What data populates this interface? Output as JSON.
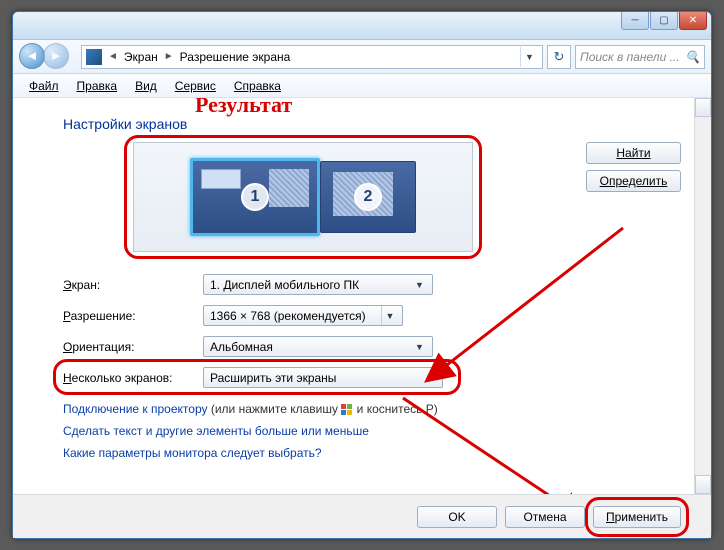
{
  "breadcrumb": {
    "item1": "Экран",
    "item2": "Разрешение экрана"
  },
  "search": {
    "placeholder": "Поиск в панели ..."
  },
  "menu": {
    "file": "Файл",
    "edit": "Правка",
    "view": "Вид",
    "tools": "Сервис",
    "help": "Справка"
  },
  "heading": "Настройки экранов",
  "monitors": {
    "m1": "1",
    "m2": "2"
  },
  "side": {
    "find": "Найти",
    "detect": "Определить"
  },
  "form": {
    "screen_label": "Экран:",
    "screen_value": "1. Дисплей мобильного ПК",
    "res_label": "Разрешение:",
    "res_value": "1366 × 768 (рекомендуется)",
    "orient_label": "Ориентация:",
    "orient_value": "Альбомная",
    "multi_label": "Несколько экранов:",
    "multi_value": "Расширить эти экраны"
  },
  "links": {
    "projector_a": "Подключение к проектору",
    "projector_b": " (или нажмите клавишу ",
    "projector_c": " и коснитесь P)",
    "text_size": "Сделать текст и другие элементы больше или меньше",
    "which_monitor": "Какие параметры монитора следует выбрать?"
  },
  "footer": {
    "ok": "OK",
    "cancel": "Отмена",
    "apply": "Применить"
  },
  "annotation": {
    "result": "Результат"
  }
}
